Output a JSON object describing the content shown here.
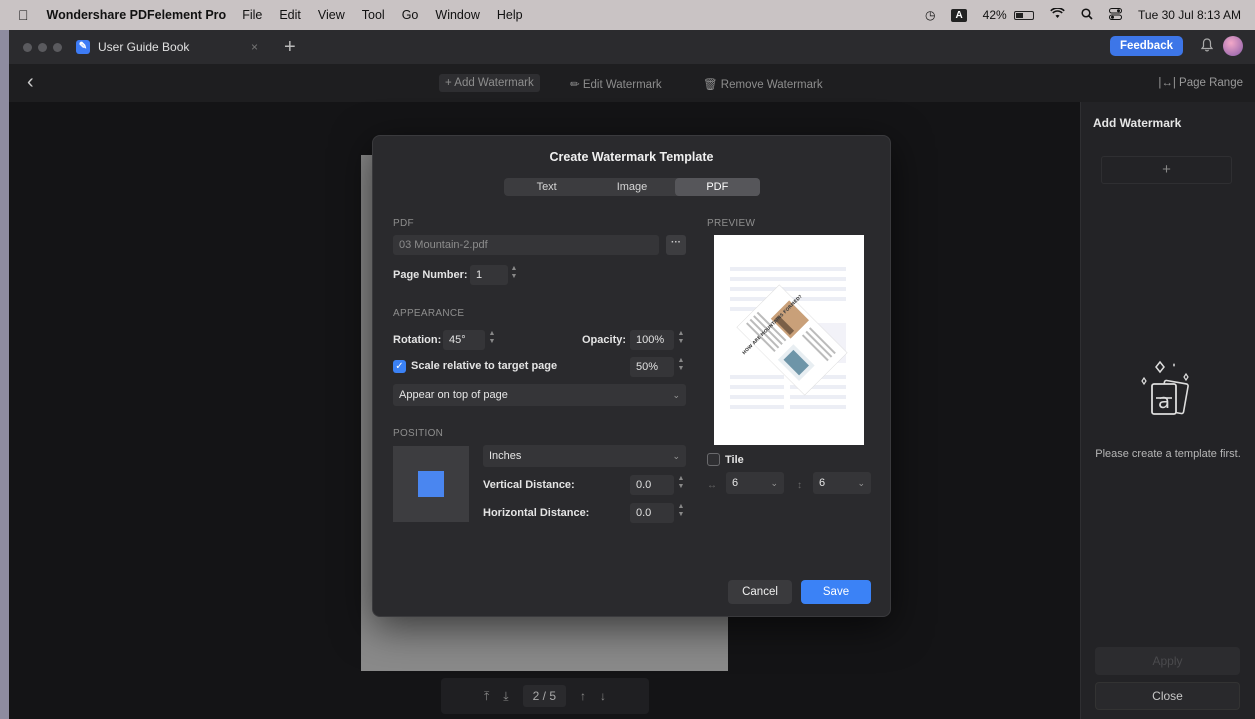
{
  "menubar": {
    "app_name": "Wondershare PDFelement Pro",
    "menus": [
      "File",
      "Edit",
      "View",
      "Tool",
      "Go",
      "Window",
      "Help"
    ],
    "input_source": "A",
    "battery": "42%",
    "battery_level": 0.42,
    "datetime": "Tue 30 Jul 8:13 AM"
  },
  "tabbar": {
    "doc_title": "User Guide Book",
    "feedback_label": "Feedback"
  },
  "toolbar": {
    "add_watermark": "+ Add Watermark",
    "edit_watermark": "Edit Watermark",
    "remove_watermark": "Remove Watermark",
    "page_range": "Page Range"
  },
  "page_nav": {
    "current": "2",
    "separator": "/",
    "total": "5"
  },
  "sidebar": {
    "title": "Add Watermark",
    "add_symbol": "+",
    "message": "Please create a template first.",
    "apply_label": "Apply",
    "close_label": "Close"
  },
  "dialog": {
    "title": "Create Watermark Template",
    "tabs": [
      "Text",
      "Image",
      "PDF"
    ],
    "selected_tab": "PDF",
    "pdf_section": "PDF",
    "pdf_file": "03 Mountain-2.pdf",
    "more_label": "···",
    "page_number_label": "Page Number:",
    "page_number": "1",
    "appearance_section": "APPEARANCE",
    "rotation_label": "Rotation:",
    "rotation": "45°",
    "opacity_label": "Opacity:",
    "opacity": "100%",
    "scale_label": "Scale relative to target page",
    "scale_checked": true,
    "scale_value": "50%",
    "layer": "Appear on top of page",
    "position_section": "POSITION",
    "units": "Inches",
    "vertical_label": "Vertical Distance:",
    "vertical_value": "0.0",
    "horizontal_label": "Horizontal Distance:",
    "horizontal_value": "0.0",
    "preview_section": "PREVIEW",
    "preview_heading": "HOW ARE MOUNTAINS FORMED?",
    "tile_label": "Tile",
    "tile_checked": false,
    "tile_cols": "6",
    "tile_rows": "6",
    "cancel_label": "Cancel",
    "save_label": "Save"
  }
}
